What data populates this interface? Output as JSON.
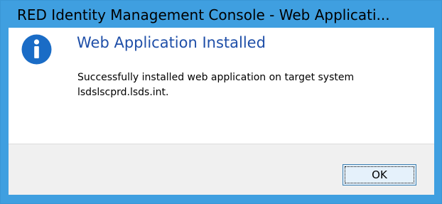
{
  "window": {
    "title": "RED Identity Management Console - Web Applicati..."
  },
  "dialog": {
    "icon": "info-icon",
    "heading": "Web Application Installed",
    "message": "Successfully installed web application on target system lsdslscprd.lsds.int.",
    "ok_label": "OK"
  },
  "colors": {
    "frame": "#3f9fe0",
    "heading": "#1f4fa8",
    "icon": "#1a6cc6",
    "footer": "#f0f0f0"
  }
}
